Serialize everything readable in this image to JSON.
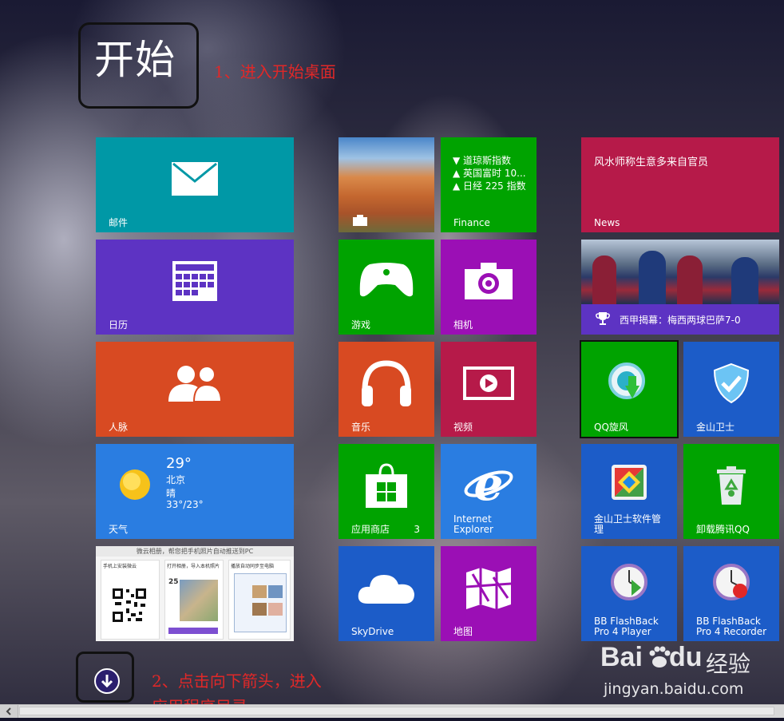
{
  "start_title": "开始",
  "annotations": {
    "step1": "1、进入开始桌面",
    "step2_line1": "2、点击向下箭头，进入",
    "step2_line2": "应用程序目录"
  },
  "colors": {
    "teal": "#0098a6",
    "purple": "#5d33c3",
    "orange": "#d84a22",
    "blue": "#2a7de1",
    "green": "#00a300",
    "magenta": "#9b0fb5",
    "crimson": "#b61a49",
    "darkblue": "#1c5cc8"
  },
  "tiles": {
    "mail": {
      "label": "邮件",
      "icon": "envelope-icon"
    },
    "calendar": {
      "label": "日历",
      "icon": "calendar-icon"
    },
    "people": {
      "label": "人脉",
      "icon": "people-icon"
    },
    "weather": {
      "label": "天气",
      "temp": "29°",
      "city": "北京",
      "condition": "晴",
      "range": "33°/23°",
      "icon": "sun-icon"
    },
    "photos": {
      "icon": "photos-icon"
    },
    "finance": {
      "label": "Finance",
      "lines": [
        "▼ 道琼斯指数",
        "▲ 英国富时 10...",
        "▲ 日经 225 指数"
      ]
    },
    "news": {
      "label": "News",
      "headline": "风水师称生意多来自官员"
    },
    "sport": {
      "headline": "西甲揭幕：梅西两球巴萨7-0",
      "icon": "trophy-icon"
    },
    "games": {
      "label": "游戏",
      "icon": "gamepad-icon"
    },
    "camera": {
      "label": "相机",
      "icon": "camera-icon"
    },
    "music": {
      "label": "音乐",
      "icon": "headphones-icon"
    },
    "video": {
      "label": "视频",
      "icon": "play-icon"
    },
    "store": {
      "label": "应用商店",
      "badge": "3",
      "icon": "store-bag-icon"
    },
    "ie": {
      "label": "Internet\nExplorer",
      "icon": "ie-icon"
    },
    "skydrive": {
      "label": "SkyDrive",
      "icon": "cloud-icon"
    },
    "maps": {
      "label": "地图",
      "icon": "map-icon"
    },
    "qqxf": {
      "label": "QQ旋风",
      "icon": "qqxuanfeng-icon"
    },
    "jsws": {
      "label": "金山卫士",
      "icon": "shield-icon"
    },
    "jswsmgr": {
      "label": "金山卫士软件管\n理",
      "icon": "software-manager-icon"
    },
    "uninstallqq": {
      "label": "卸载腾讯QQ",
      "icon": "recycle-bin-icon"
    },
    "bbplayer": {
      "label": "BB FlashBack\nPro 4 Player",
      "icon": "clock-icon"
    },
    "bbrecorder": {
      "label": "BB FlashBack\nPro 4 Recorder",
      "icon": "clock-record-icon"
    },
    "weiyun": {
      "header": "微云相册，帮您把手机照片自动推送到PC",
      "step_a": "手机上安装微云",
      "step_b": "打开相册，导入本机照片",
      "step_c": "播放自动同步至电脑",
      "num": "25"
    }
  },
  "watermark": {
    "brand": "Bai",
    "brand2": "du",
    "cn": "经验",
    "url": "jingyan.baidu.com"
  }
}
